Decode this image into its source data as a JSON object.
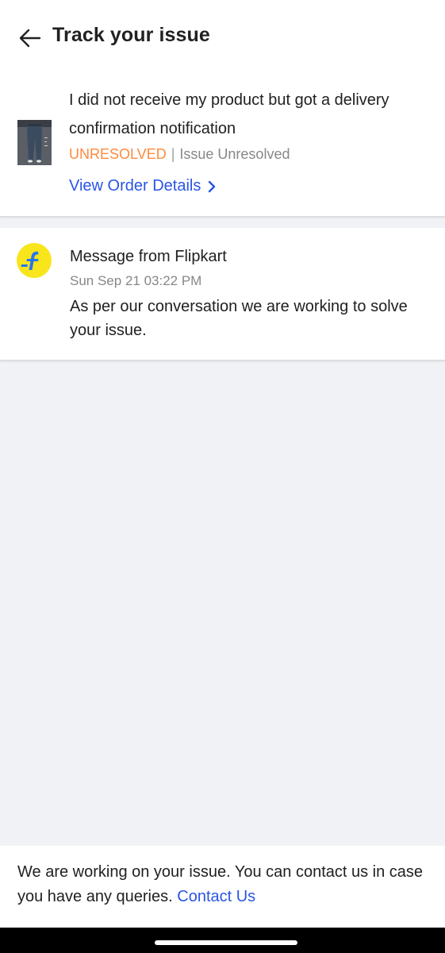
{
  "header": {
    "title": "Track your issue"
  },
  "issue": {
    "title": "I did not receive my product but got a delivery confirmation notification",
    "status_badge": "UNRESOLVED",
    "separator": "|",
    "status_text": "Issue Unresolved",
    "view_order_label": "View Order Details",
    "status_color": "#ff8a3d"
  },
  "message": {
    "sender": "Message from Flipkart",
    "timestamp": "Sun Sep 21 03:22 PM",
    "body": "As per our conversation we are working to solve your issue."
  },
  "footer": {
    "text": "We are working on your issue. You can contact us in case you have any queries.",
    "contact_label": "Contact Us"
  },
  "colors": {
    "accent_link": "#2a55e5",
    "brand_yellow": "#f8e51c",
    "brand_blue": "#2874f0",
    "background": "#f1f2f5"
  },
  "icons": {
    "back": "arrow-left-icon",
    "chevron": "chevron-right-icon",
    "brand": "flipkart-logo-icon"
  }
}
